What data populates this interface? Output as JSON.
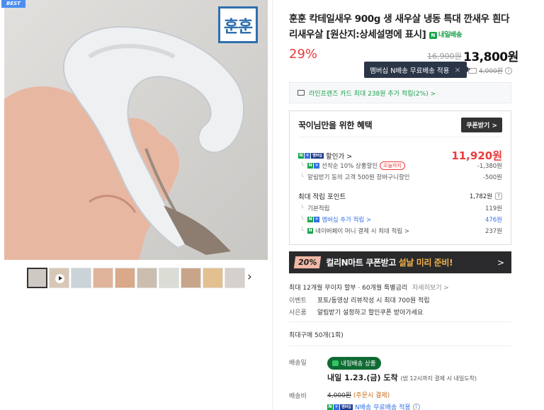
{
  "badge": "BEST",
  "product": {
    "logo_text": "훈훈",
    "title": "훈훈 칵테일새우 900g 생 새우살 냉동 특대 깐새우 흰다리새우살 [원산지:상세설명에 표시]",
    "tomorrow_badge": "내일배송",
    "discount": "29%",
    "original_price": "16,900원",
    "sale_price": "13,800원"
  },
  "tooltip": {
    "text": "멤버십 N배송 무료배송 적용",
    "close": "×"
  },
  "shipping_old": "4,000원",
  "card_promo": "라인프렌즈 카드 최대 238원 추가 적립(2%) >",
  "benefit": {
    "heading": "꾹이님만을 위한 혜택",
    "coupon_button": "쿠폰받기 >",
    "discount_label": "할인가 >",
    "discount_price": "11,920원",
    "first_discount": "선착순 10% 상품할인",
    "first_tag": "오늘까지",
    "first_value": "-1,380원",
    "alarm_discount": "알림받기 동의 고객 500원 장바구니할인",
    "alarm_value": "-500원",
    "points_label": "최대 적립 포인트",
    "points_value": "1,782원",
    "points_help": "?",
    "basic_label": "기본적립",
    "basic_value": "119원",
    "membership_label": "멤버십 추가 적립 >",
    "membership_value": "476원",
    "npay_label": "네이버페이 머니 결제 시 최대 적립 >",
    "npay_value": "237원"
  },
  "banner": {
    "pct": "20%",
    "text_a": "컬리N마트 쿠폰받고 ",
    "text_b": "설날 미리 준비!",
    "arrow": ">"
  },
  "installment": {
    "text": "최대 12개월 무이자 할부 · 60개월 특별금리",
    "more": "자세히보기 >"
  },
  "event": {
    "label": "이벤트",
    "text": "포토/동영상 리뷰작성 시 최대 700원 적립"
  },
  "gift": {
    "label": "사은품",
    "text": "알림받기 설정하고 할인쿠폰 받아가세요"
  },
  "max_purchase": "최대구매 50개(1회)",
  "delivery": {
    "label": "배송일",
    "pill": "내일배송 상품",
    "arrival": "내일 1.23.(금) 도착",
    "arrival_note": "(밤 12시까지 결제 시 내일도착)"
  },
  "fee": {
    "label": "배송비",
    "old": "4,000원",
    "note": "(주문시 결제)",
    "free": "N배송 무료배송 적용"
  },
  "colors": {
    "accent_red": "#ec3a3a",
    "green": "#1aa34a",
    "blue": "#3570e6"
  }
}
